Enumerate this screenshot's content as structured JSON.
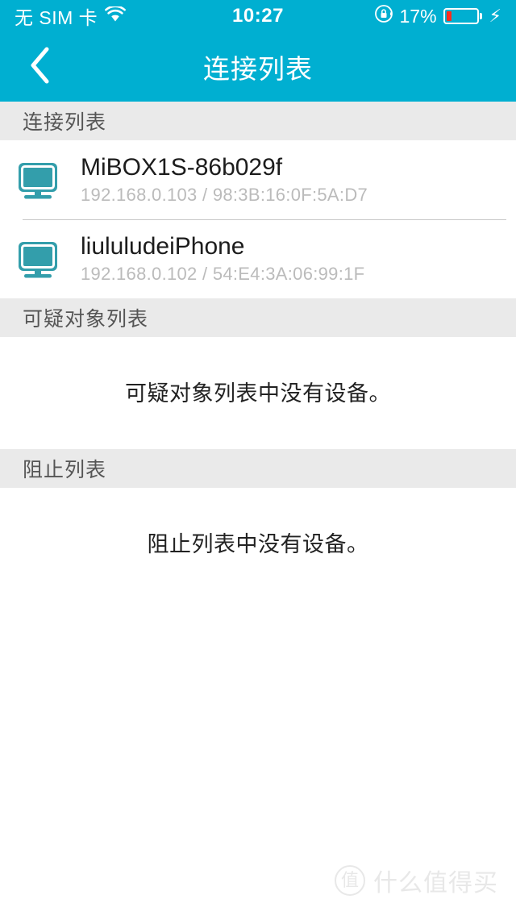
{
  "status_bar": {
    "carrier": "无 SIM 卡",
    "wifi_icon": "wifi-icon",
    "time": "10:27",
    "lock_icon": "rotation-lock-icon",
    "battery_percent": "17%",
    "battery_level": 17,
    "charging_icon": "⚡",
    "background_color": "#00AFD1",
    "text_color": "#FFFFFF",
    "battery_fill_color": "#FF2B1D"
  },
  "nav_bar": {
    "back_icon": "chevron-left-icon",
    "title": "连接列表",
    "background_color": "#00AFD1"
  },
  "sections": [
    {
      "id": "connected",
      "header": "连接列表",
      "devices": [
        {
          "icon": "monitor-icon",
          "name": "MiBOX1S-86b029f",
          "meta": "192.168.0.103 / 98:3B:16:0F:5A:D7"
        },
        {
          "icon": "monitor-icon",
          "name": "liululudeiPhone",
          "meta": "192.168.0.102 / 54:E4:3A:06:99:1F"
        }
      ],
      "empty_message": null
    },
    {
      "id": "suspicious",
      "header": "可疑对象列表",
      "devices": [],
      "empty_message": "可疑对象列表中没有设备。"
    },
    {
      "id": "blocked",
      "header": "阻止列表",
      "devices": [],
      "empty_message": "阻止列表中没有设备。"
    }
  ],
  "watermark": {
    "logo_char": "值",
    "text": "什么值得买",
    "color": "#E8E8E8"
  },
  "theme": {
    "accent": "#00AFD1",
    "section_header_bg": "#EAEAEA",
    "device_icon_color": "#339EAB",
    "meta_text_color": "#BBBBBB"
  }
}
